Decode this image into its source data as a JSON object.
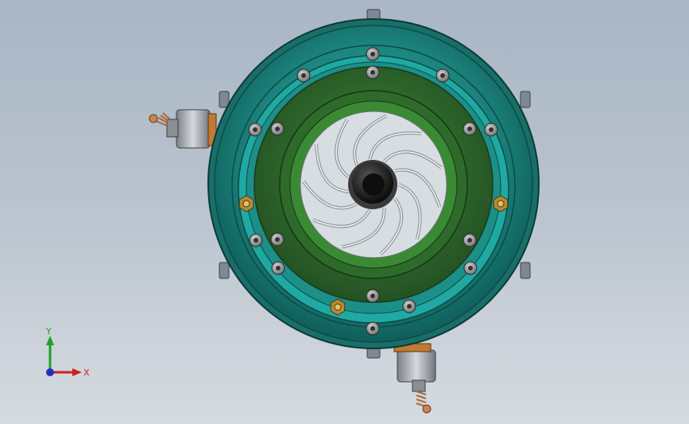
{
  "triad": {
    "x_label": "X",
    "y_label": "Y",
    "x_color": "#d02020",
    "y_color": "#20a020",
    "z_color": "#2030c0"
  },
  "model": {
    "outer_ring_color": "#1e8a84",
    "inner_ring_color": "#2f6a2c",
    "impeller_color": "#cfd6dc",
    "hub_color": "#111111",
    "nut_color": "#b88a30",
    "fitting_color": "#9aa0a6",
    "icons": [
      "housing-ring",
      "impeller",
      "hub-cap",
      "bolt-head",
      "brass-nut",
      "fitting-left",
      "fitting-bottom",
      "coordinate-triad"
    ]
  }
}
